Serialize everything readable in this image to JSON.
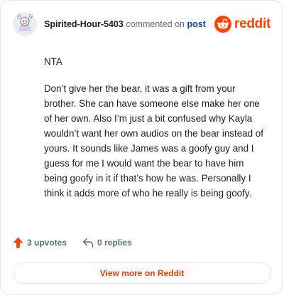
{
  "header": {
    "username": "Spirited-Hour-5403",
    "action_text": "commented on",
    "post_link": "post",
    "brand": "reddit"
  },
  "comment": {
    "paragraphs": [
      "NTA",
      "Don’t give her the bear, it was a gift from your brother. She can have someone else make her one of her own. Also I’m just a bit confused why Kayla wouldn’t want her own audios on the bear instead of yours. It sounds like James was a goofy guy and I guess for me I would want the bear to have him being goofy in it if that’s how he was. Personally I think it adds more of who he really is being goofy."
    ]
  },
  "footer": {
    "upvotes": "3 upvotes",
    "replies": "0 replies"
  },
  "cta": {
    "label": "View more on Reddit"
  },
  "colors": {
    "brand": "#ff4500",
    "link": "#0a449b",
    "muted": "#576f76"
  }
}
